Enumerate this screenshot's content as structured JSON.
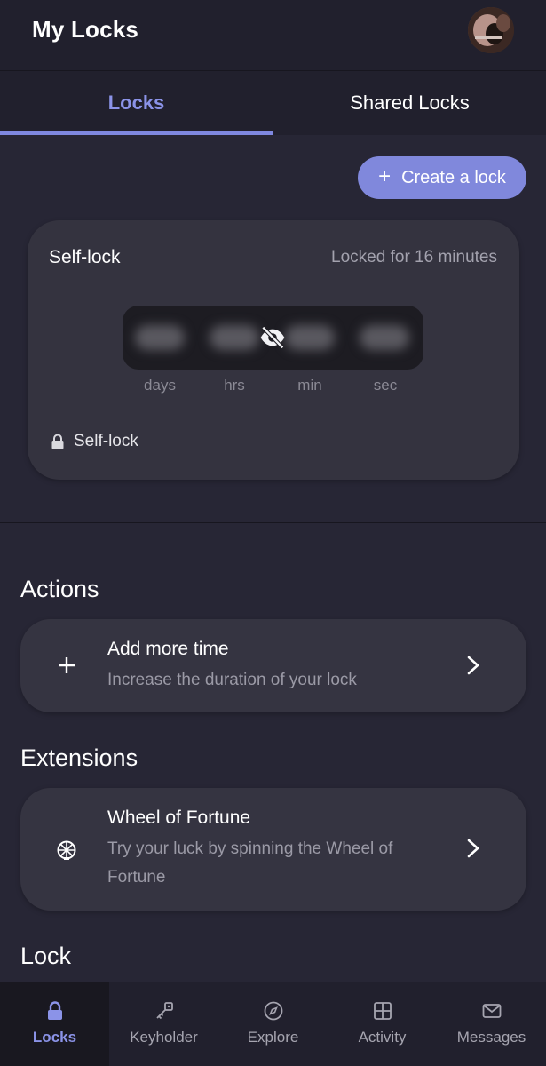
{
  "header": {
    "title": "My Locks"
  },
  "tabs": [
    {
      "label": "Locks",
      "active": true
    },
    {
      "label": "Shared Locks",
      "active": false
    }
  ],
  "create_button": {
    "label": "Create a lock"
  },
  "lock_card": {
    "title": "Self-lock",
    "status": "Locked for 16 minutes",
    "units": [
      "days",
      "hrs",
      "min",
      "sec"
    ],
    "footer_label": "Self-lock"
  },
  "actions": {
    "title": "Actions",
    "items": [
      {
        "title": "Add more time",
        "description": "Increase the duration of your lock"
      }
    ]
  },
  "extensions": {
    "title": "Extensions",
    "items": [
      {
        "title": "Wheel of Fortune",
        "description_line1": "Try your luck by spinning the Wheel of",
        "description_line2": "Fortune"
      }
    ]
  },
  "lock_section": {
    "title": "Lock"
  },
  "bottom_nav": [
    {
      "label": "Locks",
      "icon": "lock-icon",
      "active": true
    },
    {
      "label": "Keyholder",
      "icon": "key-icon",
      "active": false
    },
    {
      "label": "Explore",
      "icon": "compass-icon",
      "active": false
    },
    {
      "label": "Activity",
      "icon": "grid-icon",
      "active": false
    },
    {
      "label": "Messages",
      "icon": "envelope-icon",
      "active": false
    }
  ],
  "colors": {
    "accent": "#8088dc",
    "background": "#272635",
    "card": "#353441"
  }
}
